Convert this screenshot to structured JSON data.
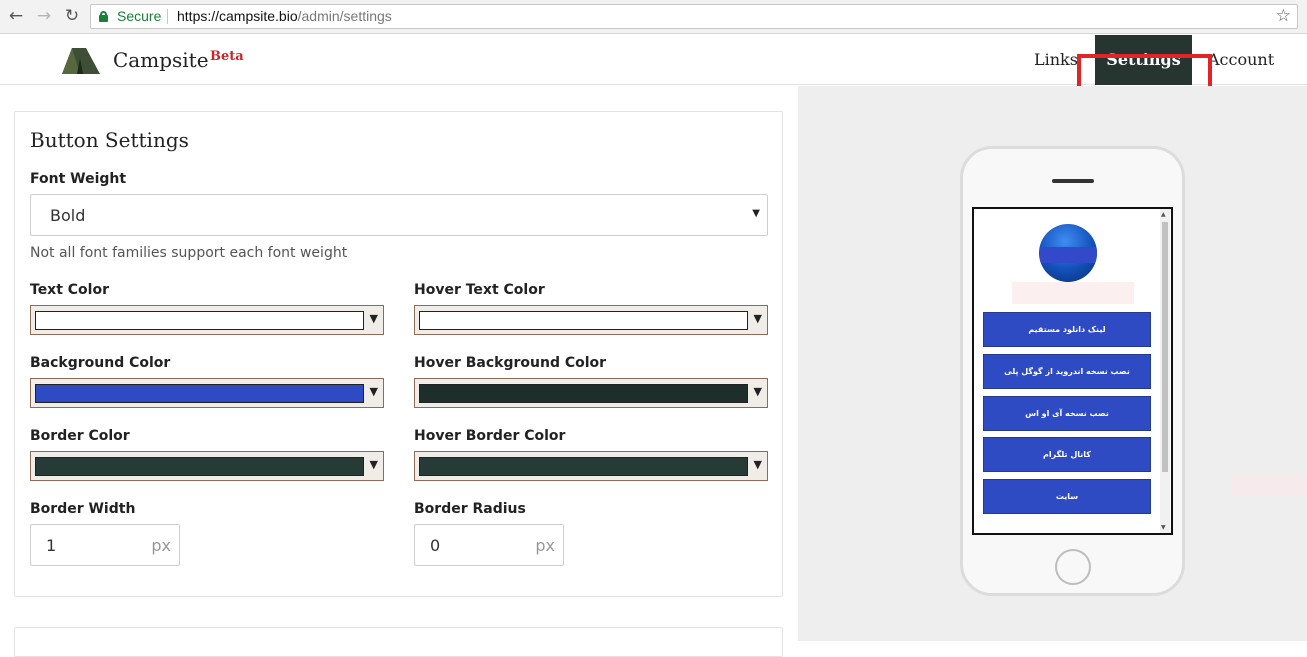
{
  "browser": {
    "secure_label": "Secure",
    "url_host": "https://campsite.bio",
    "url_path": "/admin/settings"
  },
  "header": {
    "brand": "Campsite",
    "badge": "Beta",
    "nav": [
      {
        "label": "Links"
      },
      {
        "label": "Settings",
        "active": true
      },
      {
        "label": "Account"
      }
    ]
  },
  "button_settings": {
    "title": "Button Settings",
    "font_weight": {
      "label": "Font Weight",
      "value": "Bold",
      "help": "Not all font families support each font weight"
    },
    "text_color": {
      "label": "Text Color",
      "value": "#ffffff"
    },
    "hover_text_color": {
      "label": "Hover Text Color",
      "value": "#ffffff"
    },
    "background_color": {
      "label": "Background Color",
      "value": "#2f4bc4"
    },
    "hover_background_color": {
      "label": "Hover Background Color",
      "value": "#1e2e2a"
    },
    "border_color": {
      "label": "Border Color",
      "value": "#263a36"
    },
    "hover_border_color": {
      "label": "Hover Border Color",
      "value": "#263a36"
    },
    "border_width": {
      "label": "Border Width",
      "value": "1",
      "unit": "px"
    },
    "border_radius": {
      "label": "Border Radius",
      "value": "0",
      "unit": "px"
    }
  },
  "preview": {
    "links": [
      "لینک دانلود مستقیم",
      "نصب نسخه اندروید از گوگل پلی",
      "نصب نسخه آی او اس",
      "کانال تلگرام",
      "سایت"
    ]
  }
}
